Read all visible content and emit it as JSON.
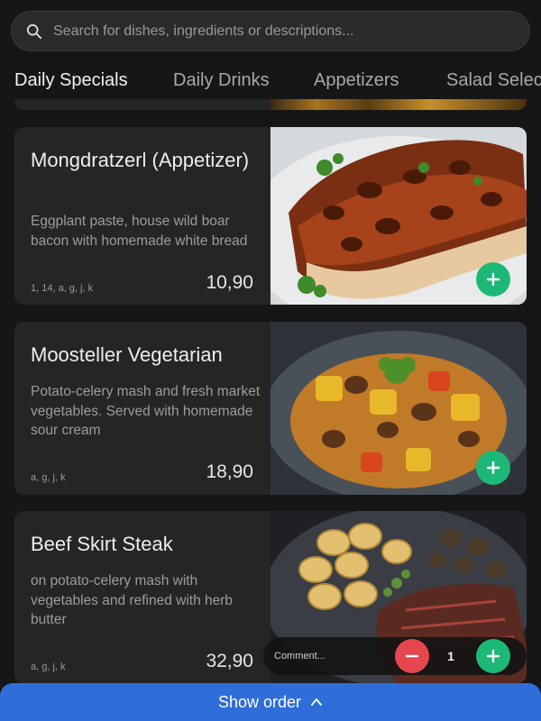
{
  "search": {
    "placeholder": "Search for dishes, ingredients or descriptions...",
    "icon": "search-icon"
  },
  "tabs": [
    {
      "label": "Daily Specials",
      "active": true
    },
    {
      "label": "Daily Drinks",
      "active": false
    },
    {
      "label": "Appetizers",
      "active": false
    },
    {
      "label": "Salad Selec",
      "active": false
    }
  ],
  "dishes": [
    {
      "title": "Mongdratzerl (Appetizer)",
      "description": "Eggplant paste, house wild boar bacon with homemade white bread",
      "allergens": "1, 14, a, g, j, k",
      "price": "10,90"
    },
    {
      "title": "Moosteller Vegetarian",
      "description": "Potato-celery mash and fresh market vegetables. Served with homemade sour cream",
      "allergens": "a, g, j, k",
      "price": "18,90"
    },
    {
      "title": "Beef Skirt Steak",
      "description": "on potato-celery mash with vegetables and refined with herb butter",
      "allergens": "a, g, j, k",
      "price": "32,90"
    }
  ],
  "order_controls": {
    "comment_placeholder": "Comment...",
    "quantity": "1"
  },
  "footer": {
    "show_order_label": "Show order"
  },
  "colors": {
    "accent_blue": "#2f6dd8",
    "add_green": "#1db877",
    "remove_red": "#e5474f",
    "background": "#161616",
    "card": "#252525"
  }
}
